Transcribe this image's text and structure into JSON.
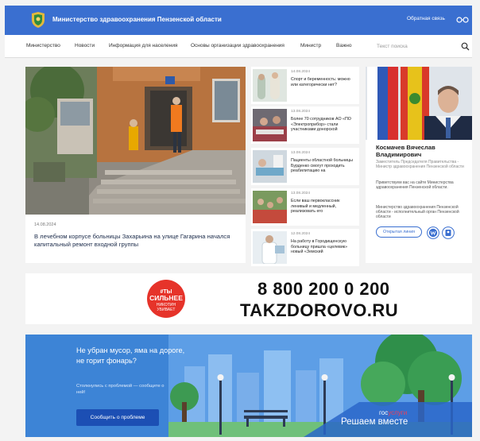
{
  "header": {
    "title": "Министерство здравоохранения Пензенской области",
    "feedback_label": "Обратная связь"
  },
  "nav": {
    "items": [
      "Министерство",
      "Новости",
      "Информация для населения",
      "Основы организации здравоохранения",
      "Министр",
      "Важно"
    ],
    "search_placeholder": "Текст поиска"
  },
  "main_news": {
    "date": "14.08.2024",
    "title": "В лечебном корпусе больницы Захарьина на улице Гагарина начался капитальный ремонт входной группы"
  },
  "side_news": [
    {
      "date": "14.08.2024",
      "title": "Спорт и беременность: можно или категорически нет?"
    },
    {
      "date": "13.08.2024",
      "title": "Более 70 сотрудников АО «ПО «Электроприбор» стали участниками донорской"
    },
    {
      "date": "13.08.2024",
      "title": "Пациенты областной больницы Бурденко смогут проходить реабилитацию на"
    },
    {
      "date": "13.08.2024",
      "title": "Если ваш первоклассник ленивый и медленный, реализовать его"
    },
    {
      "date": "12.08.2024",
      "title": "На работу в Городищенскую больницу пришла «целевик» новый «Земский"
    }
  ],
  "minister": {
    "name": "Космачев Вячеслав Владимирович",
    "position": "Заместитель Председателя Правительства - Министр здравоохранения Пензенской области",
    "welcome": "Приветствуем вас на сайте Министерства здравоохранения Пензенской области.",
    "about": "Министерство здравоохранения Пензенской области - исполнительный орган Пензенской области",
    "open_line_label": "Открытая линия"
  },
  "banner_hotline": {
    "badge_line1": "#ТЫ",
    "badge_line2": "СИЛЬНЕЕ",
    "badge_line3": "НИКОТИН",
    "badge_line4": "УБИВАЕТ",
    "phone": "8 800 200 0 200",
    "site": "TAKZDOROVO.RU"
  },
  "banner_gosuslugi": {
    "title": "Не убран мусор, яма на дороге, не горит фонарь?",
    "subtitle": "Столкнулись с проблемой — сообщите о ней!",
    "button_label": "Сообщить о проблеме",
    "brand_gos": "гос",
    "brand_uslugi": "услуги",
    "slogan": "Решаем вместе"
  },
  "colors": {
    "brand_blue": "#3a6fd0",
    "button_blue": "#1c4fb4",
    "badge_red": "#e6332a"
  }
}
